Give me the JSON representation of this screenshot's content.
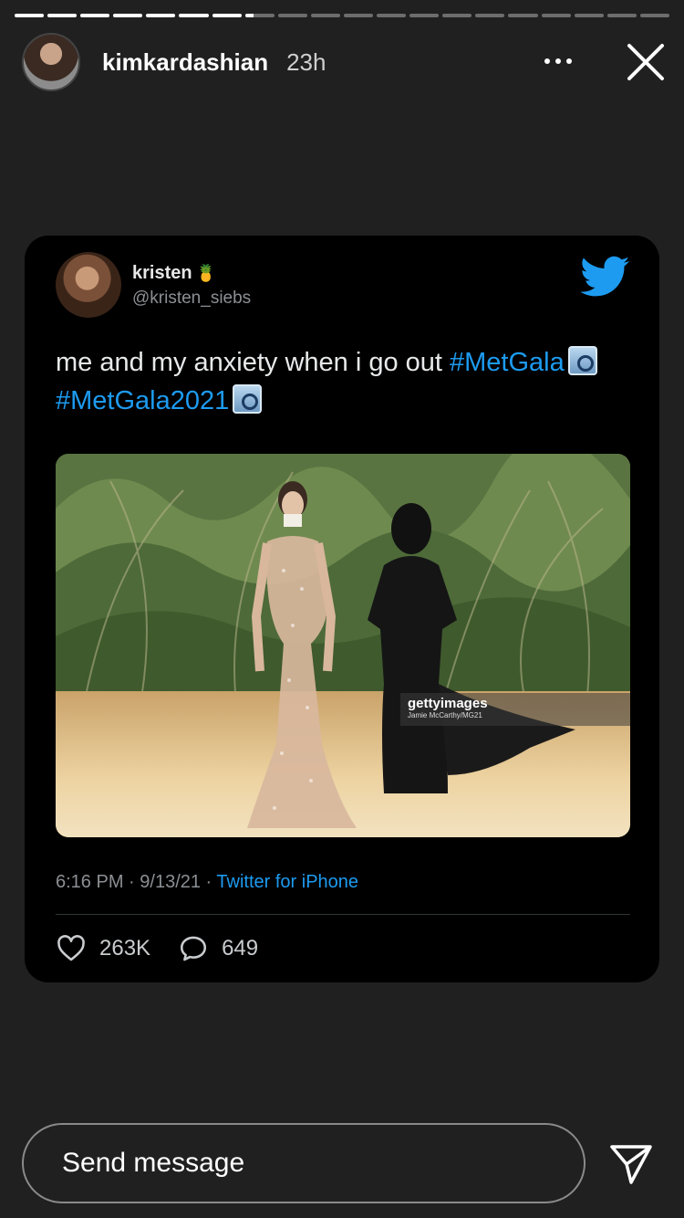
{
  "story": {
    "segments_total": 20,
    "segments_completed": 7,
    "current_segment_progress": 0.3
  },
  "header": {
    "username": "kimkardashian",
    "time": "23h"
  },
  "tweet": {
    "name": "kristen",
    "name_emoji": "🍍",
    "handle": "@kristen_siebs",
    "text_plain": "me and my anxiety when i go out ",
    "hashtag1": "#MetGala",
    "hashtag2": "#MetGala2021",
    "photo_watermark_brand": "gettyimages",
    "photo_watermark_credit": "Jamie McCarthy/MG21",
    "time": "6:16 PM",
    "date": "9/13/21",
    "source": "Twitter for iPhone",
    "likes": "263K",
    "replies": "649"
  },
  "bottom": {
    "message_placeholder": "Send message"
  }
}
